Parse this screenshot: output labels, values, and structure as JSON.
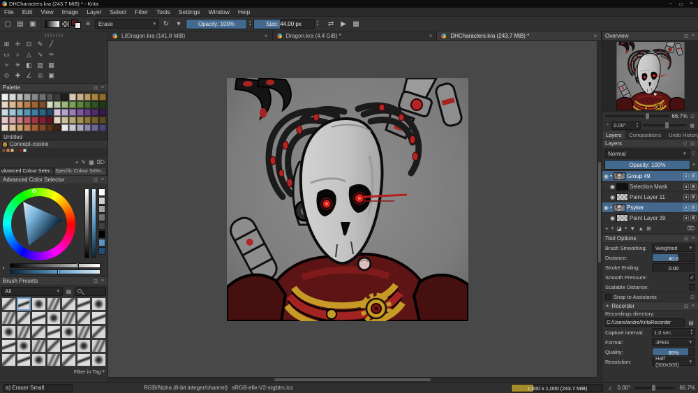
{
  "window": {
    "title": "DHCharacters.kra (243.7 MiB) * - Krita"
  },
  "icons": {
    "close": "×",
    "minimize": "–",
    "maximize": "▭",
    "caret_down": "▾",
    "caret_up": "▴",
    "caret_right": "▸",
    "eye": "◉",
    "float": "⊡",
    "plus": "+",
    "pencil": "✎",
    "trash": "⌦",
    "folder": "▤",
    "reload": "↻",
    "mirror": "⇄",
    "play": "▶",
    "wrap": "▦",
    "menu_check": "✓",
    "alpha_badge": "a",
    "props_badge": "⊞",
    "angle": "∠",
    "record": "●",
    "filter": "▽",
    "grid": "▦",
    "new_doc": "▢",
    "open_doc": "▤",
    "save_doc": "▣",
    "brush_settings": "≡",
    "mask": "◪",
    "move_down": "▼",
    "move_up": "▲",
    "duplicate": "⊞",
    "properties": "≡",
    "shade": "◑",
    "rotate": "◔",
    "tag": "▤"
  },
  "menu": {
    "items": [
      "File",
      "Edit",
      "View",
      "Image",
      "Layer",
      "Select",
      "Filter",
      "Tools",
      "Settings",
      "Window",
      "Help"
    ]
  },
  "toolbar": {
    "brush_blending": "Erase",
    "opacity_label": "Opacity: 100%",
    "size_label": "Size: 44.00 px"
  },
  "doc_tabs": [
    {
      "label": "LilDragon.kra (141.8 MiB)",
      "active": false
    },
    {
      "label": "Dragon.kra (4.4 GiB) *",
      "active": false
    },
    {
      "label": "DHCharacters.kra (243.7 MiB) *",
      "active": true
    }
  ],
  "toolbox": {
    "tools": [
      {
        "name": "transform-tool",
        "glyph": "⊞"
      },
      {
        "name": "move-tool",
        "glyph": "✛"
      },
      {
        "name": "crop-tool",
        "glyph": "⊡"
      },
      {
        "name": "freehand-brush-tool",
        "glyph": "✎"
      },
      {
        "name": "line-tool",
        "glyph": "╱"
      },
      {
        "name": "rectangle-tool",
        "glyph": "▭"
      },
      {
        "name": "ellipse-tool",
        "glyph": "○"
      },
      {
        "name": "polygon-tool",
        "glyph": "△"
      },
      {
        "name": "polyline-tool",
        "glyph": "∿"
      },
      {
        "name": "bezier-curve-tool",
        "glyph": "✑"
      },
      {
        "name": "dynamic-brush-tool",
        "glyph": "≈"
      },
      {
        "name": "multibrush-tool",
        "glyph": "✳"
      },
      {
        "name": "fill-tool",
        "glyph": "◧"
      },
      {
        "name": "gradient-tool",
        "glyph": "▨"
      },
      {
        "name": "pattern-tool",
        "glyph": "▦"
      },
      {
        "name": "color-picker-tool",
        "glyph": "⊙"
      },
      {
        "name": "assistants-tool",
        "glyph": "✚"
      },
      {
        "name": "measure-tool",
        "glyph": "∠"
      },
      {
        "name": "zoom-tool",
        "glyph": "◎"
      },
      {
        "name": "reference-images-tool",
        "glyph": "▣"
      }
    ]
  },
  "palette": {
    "title": "Palette",
    "untitled": "Untitled",
    "concept": "Concept-cookie",
    "tab_advanced": "Advanced Colour Selec...",
    "tab_specific": "Specific Colour Selec...",
    "rows": [
      [
        "#f2f2f2",
        "#d8d8d8",
        "#bdbdbd",
        "#a3a3a3",
        "#888888",
        "#6e6e6e",
        "#545454",
        "#393939",
        "#1f1f1f",
        "#d9cbb3",
        "#c9b28a",
        "#b89a62",
        "#a7823c",
        "#8f6b2d"
      ],
      [
        "#e8d5c0",
        "#dab896",
        "#cc9b6c",
        "#b77e49",
        "#9c6436",
        "#7e4e2a",
        "#d8e0c8",
        "#b9cba2",
        "#9ab67c",
        "#7aa158",
        "#5c8842",
        "#436d31",
        "#2f5224",
        "#1f3a19"
      ],
      [
        "#c8dce4",
        "#a3c6d6",
        "#7dafc8",
        "#5897b9",
        "#3f7ea3",
        "#2f6485",
        "#234b66",
        "#d6c8e0",
        "#b9a3cc",
        "#9c7eb8",
        "#8059a3",
        "#663f87",
        "#4d2c68",
        "#351d4a"
      ],
      [
        "#e4c8c8",
        "#d6a3a6",
        "#c87d84",
        "#b85862",
        "#a33746",
        "#851f33",
        "#661425",
        "#e0d6c0",
        "#ccbf9c",
        "#b8a878",
        "#a39056",
        "#8c783d",
        "#75602c",
        "#5e4a1f"
      ],
      [
        "#f0e0d0",
        "#e0c0a0",
        "#d0a070",
        "#c08050",
        "#a06038",
        "#804828",
        "#603418",
        "#402410",
        "#e8e8f0",
        "#c8c8d8",
        "#a8a8c0",
        "#8888a8",
        "#686890",
        "#484878"
      ]
    ],
    "concept_colors": [
      "#8c5a3c",
      "#c89058",
      "#e8c088",
      "#3c3c3c",
      "#9c2c24",
      "#d8d8d8"
    ]
  },
  "acs": {
    "title": "Advanced Color Selector",
    "chips": [
      "#ffffff",
      "#d0d0d0",
      "#a0a0a0",
      "#707070",
      "#404040",
      "#000000",
      "#5a94c4",
      "#1f4e79"
    ]
  },
  "brush_presets": {
    "title": "Brush Presets",
    "filter_dropdown": "All",
    "count": 35,
    "selected_index": 1,
    "filter_in_tag": "Filter in Tag"
  },
  "overview": {
    "title": "Overview",
    "zoom": "66.7%",
    "rotation": "0.00°"
  },
  "right_tabs": [
    "Layers",
    "Compositions",
    "Undo History"
  ],
  "layers_panel": {
    "title": "Layers",
    "blend_mode": "Normal",
    "opacity": "Opacity: 100%",
    "layers": [
      {
        "name": "Group 49",
        "selected": true,
        "indent": 0,
        "caret": "caret_down",
        "thumb": "art"
      },
      {
        "name": "Selection Mask",
        "selected": false,
        "indent": 1,
        "thumb": "dark"
      },
      {
        "name": "Paint Layer 11",
        "selected": false,
        "indent": 1,
        "thumb": "checker"
      },
      {
        "name": "Psyker",
        "selected": true,
        "indent": 0,
        "caret": "caret_down",
        "thumb": "art"
      },
      {
        "name": "Paint Layer 39",
        "selected": false,
        "indent": 1,
        "thumb": "checker"
      }
    ]
  },
  "tool_options": {
    "title": "Tool Options",
    "brush_smoothing_label": "Brush Smoothing:",
    "brush_smoothing_value": "Weighted",
    "distance_label": "Distance:",
    "distance_value": "40.0",
    "stroke_ending_label": "Stroke Ending:",
    "stroke_ending_value": "0.00",
    "smooth_pressure_label": "Smooth Pressure:",
    "scalable_distance_label": "Scalable Distance:",
    "snap_label": "Snap to Assistants"
  },
  "recorder": {
    "title": "Recorder",
    "dir_label": "Recordings directory:",
    "dir_value": "C:/Users/andre/KritaRecorder",
    "interval_label": "Capture interval:",
    "interval_value": "1.0 sec.",
    "format_label": "Format:",
    "format_value": "JPEG",
    "quality_label": "Quality:",
    "quality_value": "85%",
    "resolution_label": "Resolution:",
    "resolution_value": "Half (500x500)"
  },
  "status_bar": {
    "brush_name": "a) Eraser Small",
    "color_model": "RGB/Alpha (8-bit integer/channel)",
    "profile": "sRGB-elle-V2-srgbtrc.icc",
    "dimensions": "1,000 x 1,000 (243.7 MiB)",
    "angle": "0.00°",
    "zoom": "66.7%"
  }
}
